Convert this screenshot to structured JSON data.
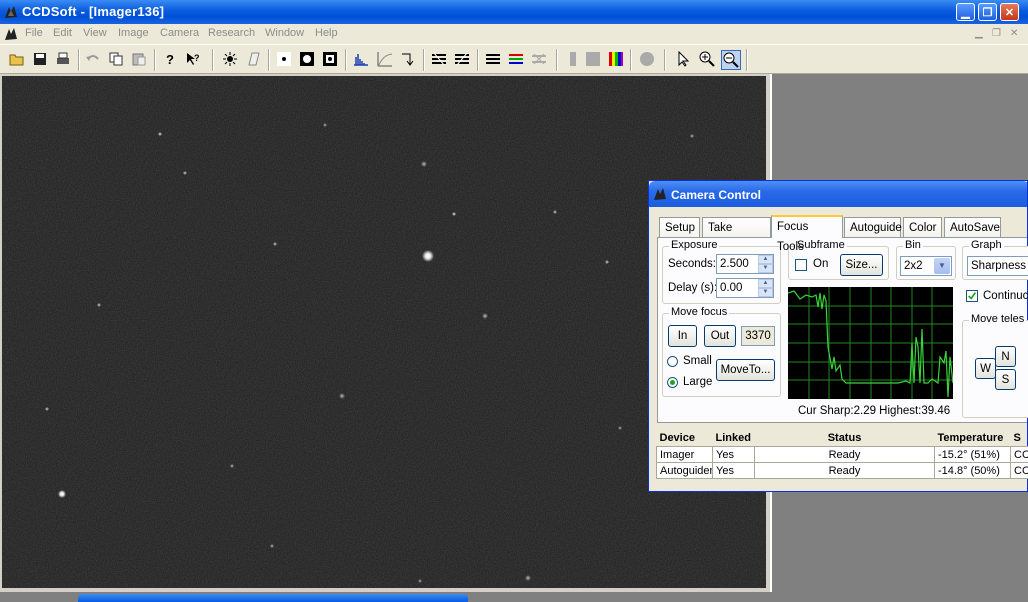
{
  "app": {
    "title": "CCDSoft  - [Imager136]"
  },
  "menubar": {
    "items": [
      "File",
      "Edit",
      "View",
      "Image",
      "Camera",
      "Research",
      "Window",
      "Help"
    ]
  },
  "toolbar": {
    "icons": [
      "open-icon",
      "save-icon",
      "print-icon",
      "undo-icon",
      "copy-icon",
      "paste-icon",
      "help-icon",
      "context-help-icon",
      "brightness-icon",
      "dark-frame-icon",
      "star-icon",
      "bright-star-icon",
      "stars-icon",
      "histogram-icon",
      "curve-icon",
      "measure-icon",
      "flip-horizontal-icon",
      "flip-vertical-icon",
      "rotate-icon",
      "rgb-icon",
      "combine-icon",
      "stop-icon",
      "gray-square-icon",
      "color-bars-icon",
      "record-icon",
      "pointer-icon",
      "zoom-in-icon",
      "zoom-out-icon"
    ]
  },
  "camera_control": {
    "title": "Camera Control",
    "tabs": [
      "Setup",
      "Take Image",
      "Focus Tools",
      "Autoguide",
      "Color",
      "AutoSave"
    ],
    "active_tab": "Focus Tools",
    "exposure": {
      "title": "Exposure",
      "seconds_label": "Seconds:",
      "seconds_value": "2.500",
      "delay_label": "Delay (s):",
      "delay_value": "0.00"
    },
    "subframe": {
      "title": "Subframe",
      "on_label": "On",
      "on_checked": false,
      "size_button": "Size..."
    },
    "bin": {
      "title": "Bin",
      "value": "2x2"
    },
    "graph_group": {
      "title": "Graph",
      "value": "Sharpness",
      "continuous_label": "Continuc",
      "continuous_checked": true
    },
    "move_focus": {
      "title": "Move focus",
      "in_button": "In",
      "out_button": "Out",
      "position": "3370",
      "small_label": "Small",
      "large_label": "Large",
      "selected": "Large",
      "moveto_button": "MoveTo..."
    },
    "move_telescope": {
      "title": "Move teles",
      "n": "N",
      "s": "S",
      "w": "W"
    },
    "sharpness_caption": "Cur Sharp:2.29 Highest:39.46",
    "device_table": {
      "headers": [
        "Device",
        "Linked",
        "Status",
        "Temperature",
        "S"
      ],
      "rows": [
        [
          "Imager",
          "Yes",
          "Ready",
          "-15.2° (51%)",
          "CC"
        ],
        [
          "Autoguider",
          "Yes",
          "Ready",
          "-14.8° (50%)",
          "CC"
        ]
      ]
    }
  },
  "colors": {
    "xp_blue": "#0a5bdc",
    "face": "#ece9d8",
    "graph_line": "#3cd23c",
    "graph_grid": "#1f8a1f"
  }
}
